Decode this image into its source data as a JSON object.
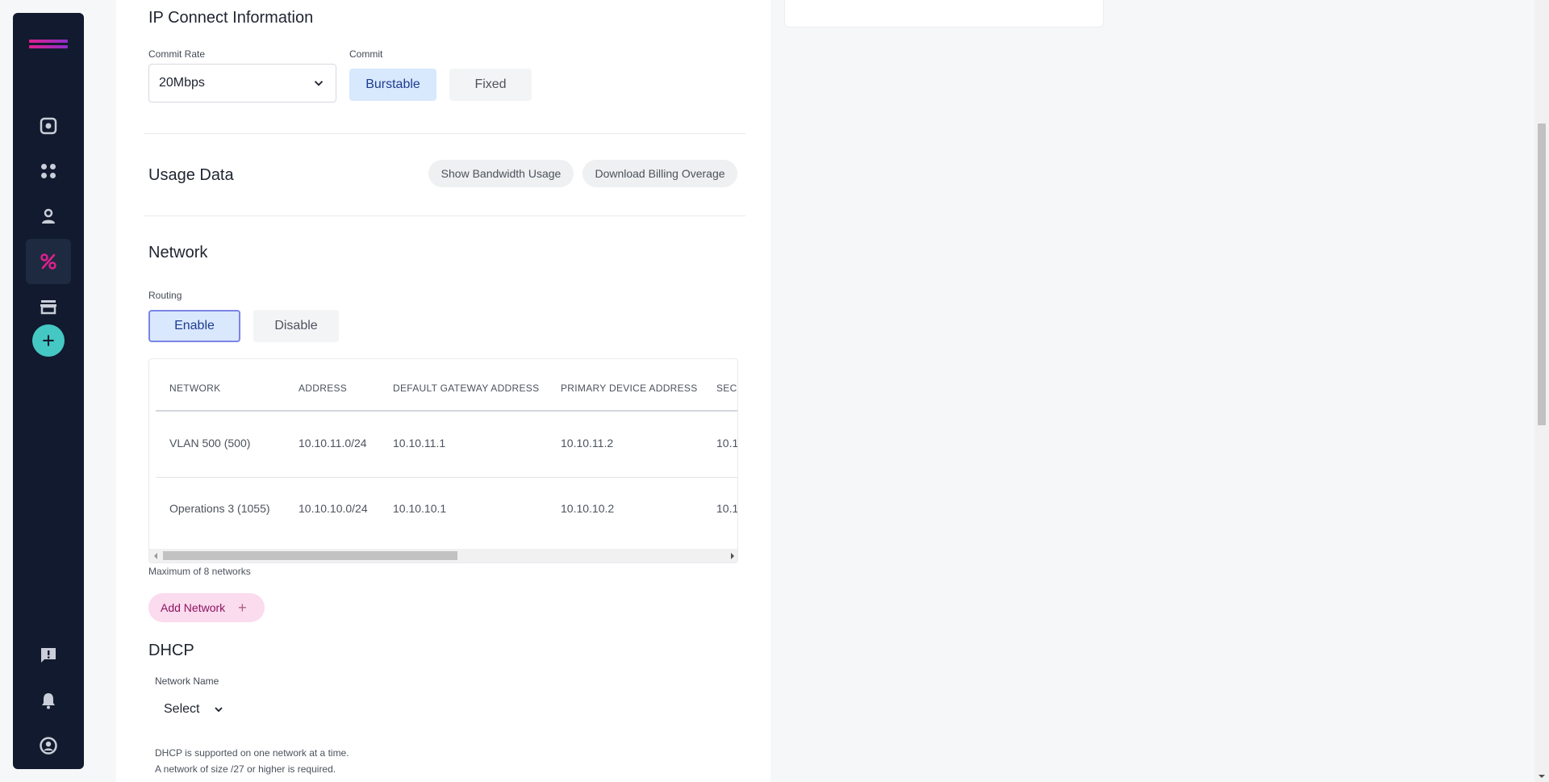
{
  "ip_connect": {
    "title": "IP Connect Information",
    "commit_rate_label": "Commit Rate",
    "commit_rate_value": "20Mbps",
    "commit_label": "Commit",
    "commit_options": [
      "Burstable",
      "Fixed"
    ],
    "commit_selected": "Burstable"
  },
  "usage": {
    "title": "Usage Data",
    "show_bandwidth": "Show Bandwidth Usage",
    "download_billing": "Download Billing Overage"
  },
  "network": {
    "title": "Network",
    "routing_label": "Routing",
    "routing_options": [
      "Enable",
      "Disable"
    ],
    "routing_selected": "Enable",
    "columns": [
      "NETWORK",
      "ADDRESS",
      "DEFAULT GATEWAY ADDRESS",
      "PRIMARY DEVICE ADDRESS",
      "SEC"
    ],
    "rows": [
      [
        "VLAN 500 (500)",
        "10.10.11.0/24",
        "10.10.11.1",
        "10.10.11.2",
        "10.1"
      ],
      [
        "Operations 3 (1055)",
        "10.10.10.0/24",
        "10.10.10.1",
        "10.10.10.2",
        "10.1"
      ]
    ],
    "max_note": "Maximum of 8 networks",
    "add_button": "Add Network"
  },
  "dhcp": {
    "title": "DHCP",
    "network_name_label": "Network Name",
    "select_value": "Select",
    "note_lines": [
      "DHCP is supported on one network at a time.",
      "A network of size /27 or higher is required."
    ]
  },
  "sidebar": {
    "icons": [
      "dashboard-icon",
      "services-icon",
      "user-icon",
      "connections-icon",
      "marketplace-icon",
      "add-icon",
      "feedback-icon",
      "notifications-icon",
      "account-icon"
    ],
    "active": "connections-icon"
  },
  "colors": {
    "sidebar_bg": "#111a2e",
    "accent_pink": "#e01f8e",
    "accent_teal": "#45c8c3",
    "selected_blue": "#d8e8fd"
  }
}
